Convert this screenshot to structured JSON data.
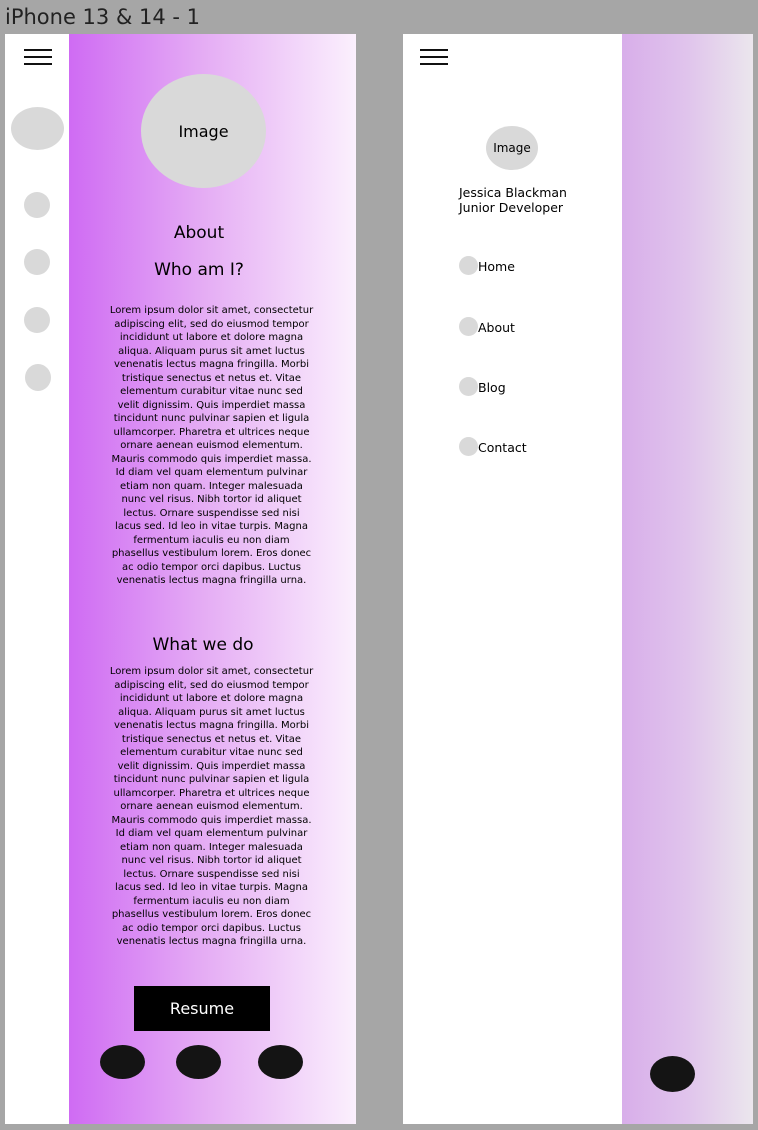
{
  "frame_title": "iPhone 13 & 14 - 1",
  "main_frame": {
    "image_label": "Image",
    "about_title": "About",
    "who_title": "Who am I?",
    "who_text": "Lorem ipsum dolor sit amet, consectetur adipiscing elit, sed do eiusmod tempor incididunt ut labore et dolore magna aliqua. Aliquam purus sit amet luctus venenatis lectus magna fringilla. Morbi tristique senectus et netus et. Vitae elementum curabitur vitae nunc sed velit dignissim. Quis imperdiet massa tincidunt nunc pulvinar sapien et ligula ullamcorper. Pharetra et ultrices neque ornare aenean euismod elementum. Mauris commodo quis imperdiet massa. Id diam vel quam elementum pulvinar etiam non quam. Integer malesuada nunc vel risus. Nibh tortor id aliquet lectus. Ornare suspendisse sed nisi lacus sed. Id leo in vitae turpis. Magna fermentum iaculis eu non diam phasellus vestibulum lorem. Eros donec ac odio tempor orci dapibus. Luctus venenatis lectus magna fringilla urna.",
    "what_title": "What we do",
    "what_text": "Lorem ipsum dolor sit amet, consectetur adipiscing elit, sed do eiusmod tempor incididunt ut labore et dolore magna aliqua. Aliquam purus sit amet luctus venenatis lectus magna fringilla. Morbi tristique senectus et netus et. Vitae elementum curabitur vitae nunc sed velit dignissim. Quis imperdiet massa tincidunt nunc pulvinar sapien et ligula ullamcorper. Pharetra et ultrices neque ornare aenean euismod elementum. Mauris commodo quis imperdiet massa. Id diam vel quam elementum pulvinar etiam non quam. Integer malesuada nunc vel risus. Nibh tortor id aliquet lectus. Ornare suspendisse sed nisi lacus sed. Id leo in vitae turpis. Magna fermentum iaculis eu non diam phasellus vestibulum lorem. Eros donec ac odio tempor orci dapibus. Luctus venenatis lectus magna fringilla urna.",
    "resume_label": "Resume"
  },
  "menu_frame": {
    "image_label": "Image",
    "name": "Jessica Blackman",
    "role": "Junior Developer",
    "nav": [
      "Home",
      "About",
      "Blog",
      "Contact"
    ]
  },
  "colors": {
    "gradient_start": "#cf6bf3",
    "gradient_end": "#fbf0fd",
    "menu_gradient_start": "#d8aeea",
    "placeholder_grey": "#d9d9d9",
    "button_black": "#000000",
    "canvas_grey": "#a6a6a6"
  }
}
